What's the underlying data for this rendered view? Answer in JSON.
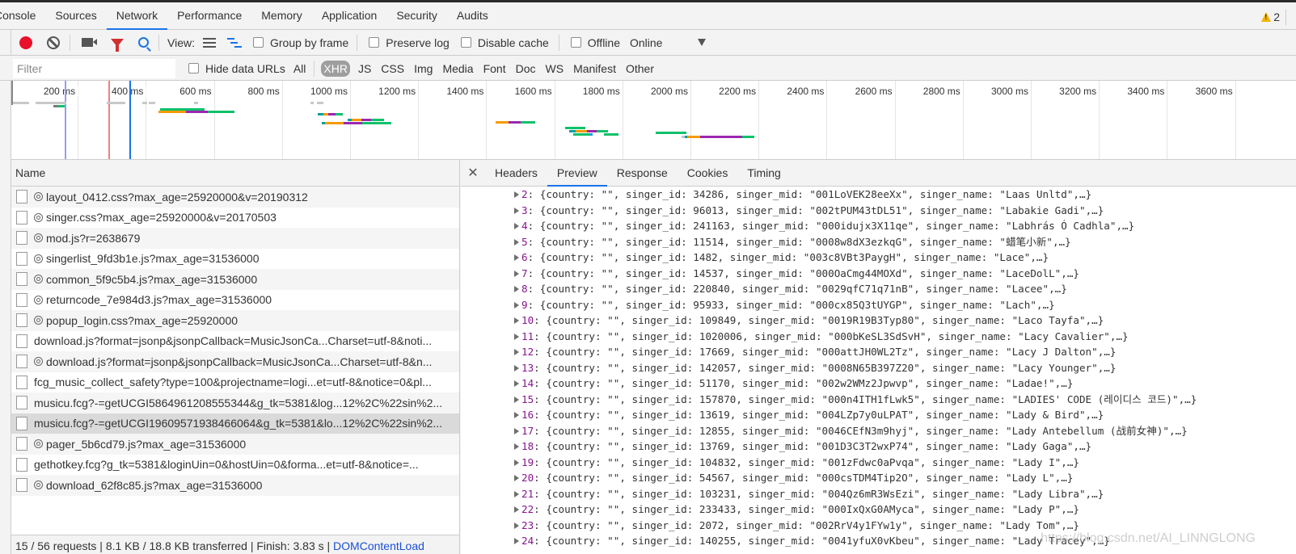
{
  "main_tabs": [
    {
      "label": "Console",
      "active": false
    },
    {
      "label": "Sources",
      "active": false
    },
    {
      "label": "Network",
      "active": true
    },
    {
      "label": "Performance",
      "active": false
    },
    {
      "label": "Memory",
      "active": false
    },
    {
      "label": "Application",
      "active": false
    },
    {
      "label": "Security",
      "active": false
    },
    {
      "label": "Audits",
      "active": false
    }
  ],
  "warnings": {
    "count": "2",
    "icon": "warning-icon"
  },
  "toolbar": {
    "record_icon": "record-icon",
    "clear_icon": "clear-icon",
    "capture_icon": "camera-icon",
    "filter_icon": "filter-icon",
    "search_icon": "search-icon",
    "view_label": "View:",
    "group_by_frame": "Group by frame",
    "preserve_log": "Preserve log",
    "disable_cache": "Disable cache",
    "offline": "Offline",
    "throttling": "Online"
  },
  "filterbar": {
    "placeholder": "Filter",
    "hide_data_urls": "Hide data URLs",
    "types": [
      {
        "label": "All",
        "active": false
      },
      {
        "label": "XHR",
        "active": true
      },
      {
        "label": "JS",
        "active": false
      },
      {
        "label": "CSS",
        "active": false
      },
      {
        "label": "Img",
        "active": false
      },
      {
        "label": "Media",
        "active": false
      },
      {
        "label": "Font",
        "active": false
      },
      {
        "label": "Doc",
        "active": false
      },
      {
        "label": "WS",
        "active": false
      },
      {
        "label": "Manifest",
        "active": false
      },
      {
        "label": "Other",
        "active": false
      }
    ]
  },
  "overview": {
    "ticks": [
      "200 ms",
      "400 ms",
      "600 ms",
      "800 ms",
      "1000 ms",
      "1200 ms",
      "1400 ms",
      "1600 ms",
      "1800 ms",
      "2000 ms",
      "2200 ms",
      "2400 ms",
      "2600 ms",
      "2800 ms",
      "3000 ms",
      "3200 ms",
      "3400 ms",
      "3600 ms"
    ],
    "colors": {
      "waiting": "#00a000",
      "queue": "#f59b00",
      "download": "#9c27b0",
      "receive": "#0fc16a",
      "dom_content_loaded": "#1a73e8",
      "load": "#f08080",
      "first_paint": "#9b9bf0"
    }
  },
  "request_list": {
    "header": "Name",
    "rows": [
      {
        "name": "layout_0412.css?max_age=25920000&v=20190312",
        "gear": true,
        "selected": false
      },
      {
        "name": "singer.css?max_age=25920000&v=20170503",
        "gear": true,
        "selected": false
      },
      {
        "name": "mod.js?r=2638679",
        "gear": true,
        "selected": false
      },
      {
        "name": "singerlist_9fd3b1e.js?max_age=31536000",
        "gear": true,
        "selected": false
      },
      {
        "name": "common_5f9c5b4.js?max_age=31536000",
        "gear": true,
        "selected": false
      },
      {
        "name": "returncode_7e984d3.js?max_age=31536000",
        "gear": true,
        "selected": false
      },
      {
        "name": "popup_login.css?max_age=25920000",
        "gear": true,
        "selected": false
      },
      {
        "name": "download.js?format=jsonp&jsonpCallback=MusicJsonCa...Charset=utf-8&noti...",
        "gear": false,
        "selected": false
      },
      {
        "name": "download.js?format=jsonp&jsonpCallback=MusicJsonCa...Charset=utf-8&n...",
        "gear": true,
        "selected": false
      },
      {
        "name": "fcg_music_collect_safety?type=100&projectname=logi...et=utf-8&notice=0&pl...",
        "gear": false,
        "selected": false
      },
      {
        "name": "musicu.fcg?-=getUCGI5864961208555344&g_tk=5381&log...12%2C%22sin%2...",
        "gear": false,
        "selected": false
      },
      {
        "name": "musicu.fcg?-=getUCGI19609571938466064&g_tk=5381&lo...12%2C%22sin%2...",
        "gear": false,
        "selected": true
      },
      {
        "name": "pager_5b6cd79.js?max_age=31536000",
        "gear": true,
        "selected": false
      },
      {
        "name": "gethotkey.fcg?g_tk=5381&loginUin=0&hostUin=0&forma...et=utf-8&notice=...",
        "gear": false,
        "selected": false
      },
      {
        "name": "download_62f8c85.js?max_age=31536000",
        "gear": true,
        "selected": false
      }
    ],
    "status": {
      "requests": "15 / 56 requests",
      "transferred": "8.1 KB / 18.8 KB transferred",
      "finish": "Finish: 3.83 s",
      "dom_content_loaded": "DOMContentLoad"
    }
  },
  "detail": {
    "close_icon": "close-icon",
    "tabs": [
      {
        "label": "Headers",
        "active": false
      },
      {
        "label": "Preview",
        "active": true
      },
      {
        "label": "Response",
        "active": false
      },
      {
        "label": "Cookies",
        "active": false
      },
      {
        "label": "Timing",
        "active": false
      }
    ],
    "preview_items": [
      {
        "index": "2",
        "country": "",
        "singer_id": "34286",
        "singer_mid": "001LoVEK28eeXx",
        "singer_name": "Laas Unltd"
      },
      {
        "index": "3",
        "country": "",
        "singer_id": "96013",
        "singer_mid": "002tPUM43tDL51",
        "singer_name": "Labakie Gadi"
      },
      {
        "index": "4",
        "country": "",
        "singer_id": "241163",
        "singer_mid": "000idujx3X11qe",
        "singer_name": "Labhrás Ó Cadhla"
      },
      {
        "index": "5",
        "country": "",
        "singer_id": "11514",
        "singer_mid": "0008w8dX3ezkqG",
        "singer_name": "蜡笔小新"
      },
      {
        "index": "6",
        "country": "",
        "singer_id": "1482",
        "singer_mid": "003c8VBt3PaygH",
        "singer_name": "Lace"
      },
      {
        "index": "7",
        "country": "",
        "singer_id": "14537",
        "singer_mid": "000OaCmg44MOXd",
        "singer_name": "LaceDolL"
      },
      {
        "index": "8",
        "country": "",
        "singer_id": "220840",
        "singer_mid": "0029qfC71q71nB",
        "singer_name": "Lacee"
      },
      {
        "index": "9",
        "country": "",
        "singer_id": "95933",
        "singer_mid": "000cx85Q3tUYGP",
        "singer_name": "Lach"
      },
      {
        "index": "10",
        "country": "",
        "singer_id": "109849",
        "singer_mid": "0019R19B3Typ80",
        "singer_name": "Laco Tayfa"
      },
      {
        "index": "11",
        "country": "",
        "singer_id": "1020006",
        "singer_mid": "000bKeSL3SdSvH",
        "singer_name": "Lacy Cavalier"
      },
      {
        "index": "12",
        "country": "",
        "singer_id": "17669",
        "singer_mid": "000attJH0WL2Tz",
        "singer_name": "Lacy J Dalton"
      },
      {
        "index": "13",
        "country": "",
        "singer_id": "142057",
        "singer_mid": "0008N65B397Z20",
        "singer_name": "Lacy Younger"
      },
      {
        "index": "14",
        "country": "",
        "singer_id": "51170",
        "singer_mid": "002w2WMz2Jpwvp",
        "singer_name": "Ladae!"
      },
      {
        "index": "15",
        "country": "",
        "singer_id": "157870",
        "singer_mid": "000n4ITH1fLwk5",
        "singer_name": "LADIES' CODE (레이디스 코드)"
      },
      {
        "index": "16",
        "country": "",
        "singer_id": "13619",
        "singer_mid": "004LZp7y0uLPAT",
        "singer_name": "Lady & Bird"
      },
      {
        "index": "17",
        "country": "",
        "singer_id": "12855",
        "singer_mid": "0046CEfN3m9hyj",
        "singer_name": "Lady Antebellum (战前女神)"
      },
      {
        "index": "18",
        "country": "",
        "singer_id": "13769",
        "singer_mid": "001D3C3T2wxP74",
        "singer_name": "Lady Gaga"
      },
      {
        "index": "19",
        "country": "",
        "singer_id": "104832",
        "singer_mid": "001zFdwc0aPvqa",
        "singer_name": "Lady I"
      },
      {
        "index": "20",
        "country": "",
        "singer_id": "54567",
        "singer_mid": "000csTDM4Tip2O",
        "singer_name": "Lady L"
      },
      {
        "index": "21",
        "country": "",
        "singer_id": "103231",
        "singer_mid": "004Qz6mR3WsEzi",
        "singer_name": "Lady Libra"
      },
      {
        "index": "22",
        "country": "",
        "singer_id": "233433",
        "singer_mid": "000IxQxG0AMyca",
        "singer_name": "Lady P"
      },
      {
        "index": "23",
        "country": "",
        "singer_id": "2072",
        "singer_mid": "002RrV4y1FYw1y",
        "singer_name": "Lady Tom"
      },
      {
        "index": "24",
        "country": "",
        "singer_id": "140255",
        "singer_mid": "0041yfuX0vKbeu",
        "singer_name": "Lady Tracey"
      }
    ]
  },
  "watermark": "https://blog.csdn.net/AI_LINNGLONG"
}
